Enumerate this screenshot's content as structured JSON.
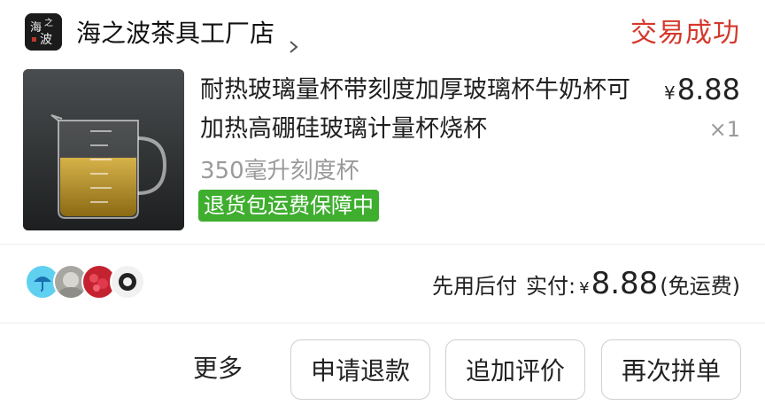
{
  "shop": {
    "logo_text": "海之波",
    "name": "海之波茶具工厂店"
  },
  "order": {
    "status": "交易成功"
  },
  "product": {
    "title": "耐热玻璃量杯带刻度加厚玻璃杯牛奶杯可加热高硼硅玻璃计量杯烧杯",
    "price_symbol": "¥",
    "price": "8.88",
    "quantity": "×1",
    "spec": "350毫升刻度杯",
    "badge": "退货包运费保障中"
  },
  "payment": {
    "method": "先用后付",
    "label": "实付:",
    "currency": "¥",
    "amount": "8.88",
    "note": "(免运费)"
  },
  "actions": {
    "more": "更多",
    "refund": "申请退款",
    "review": "追加评价",
    "rebuy": "再次拼单"
  },
  "colors": {
    "status": "#d4382c",
    "badge": "#3fae2f"
  }
}
